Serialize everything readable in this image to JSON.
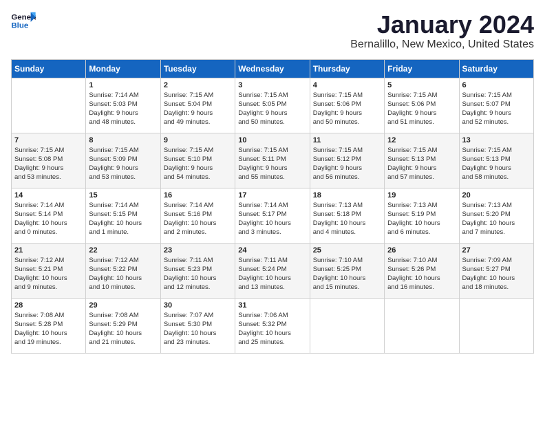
{
  "logo": {
    "line1": "General",
    "line2": "Blue"
  },
  "title": "January 2024",
  "location": "Bernalillo, New Mexico, United States",
  "days_header": [
    "Sunday",
    "Monday",
    "Tuesday",
    "Wednesday",
    "Thursday",
    "Friday",
    "Saturday"
  ],
  "weeks": [
    [
      {
        "num": "",
        "lines": []
      },
      {
        "num": "1",
        "lines": [
          "Sunrise: 7:14 AM",
          "Sunset: 5:03 PM",
          "Daylight: 9 hours",
          "and 48 minutes."
        ]
      },
      {
        "num": "2",
        "lines": [
          "Sunrise: 7:15 AM",
          "Sunset: 5:04 PM",
          "Daylight: 9 hours",
          "and 49 minutes."
        ]
      },
      {
        "num": "3",
        "lines": [
          "Sunrise: 7:15 AM",
          "Sunset: 5:05 PM",
          "Daylight: 9 hours",
          "and 50 minutes."
        ]
      },
      {
        "num": "4",
        "lines": [
          "Sunrise: 7:15 AM",
          "Sunset: 5:06 PM",
          "Daylight: 9 hours",
          "and 50 minutes."
        ]
      },
      {
        "num": "5",
        "lines": [
          "Sunrise: 7:15 AM",
          "Sunset: 5:06 PM",
          "Daylight: 9 hours",
          "and 51 minutes."
        ]
      },
      {
        "num": "6",
        "lines": [
          "Sunrise: 7:15 AM",
          "Sunset: 5:07 PM",
          "Daylight: 9 hours",
          "and 52 minutes."
        ]
      }
    ],
    [
      {
        "num": "7",
        "lines": [
          "Sunrise: 7:15 AM",
          "Sunset: 5:08 PM",
          "Daylight: 9 hours",
          "and 53 minutes."
        ]
      },
      {
        "num": "8",
        "lines": [
          "Sunrise: 7:15 AM",
          "Sunset: 5:09 PM",
          "Daylight: 9 hours",
          "and 53 minutes."
        ]
      },
      {
        "num": "9",
        "lines": [
          "Sunrise: 7:15 AM",
          "Sunset: 5:10 PM",
          "Daylight: 9 hours",
          "and 54 minutes."
        ]
      },
      {
        "num": "10",
        "lines": [
          "Sunrise: 7:15 AM",
          "Sunset: 5:11 PM",
          "Daylight: 9 hours",
          "and 55 minutes."
        ]
      },
      {
        "num": "11",
        "lines": [
          "Sunrise: 7:15 AM",
          "Sunset: 5:12 PM",
          "Daylight: 9 hours",
          "and 56 minutes."
        ]
      },
      {
        "num": "12",
        "lines": [
          "Sunrise: 7:15 AM",
          "Sunset: 5:13 PM",
          "Daylight: 9 hours",
          "and 57 minutes."
        ]
      },
      {
        "num": "13",
        "lines": [
          "Sunrise: 7:15 AM",
          "Sunset: 5:13 PM",
          "Daylight: 9 hours",
          "and 58 minutes."
        ]
      }
    ],
    [
      {
        "num": "14",
        "lines": [
          "Sunrise: 7:14 AM",
          "Sunset: 5:14 PM",
          "Daylight: 10 hours",
          "and 0 minutes."
        ]
      },
      {
        "num": "15",
        "lines": [
          "Sunrise: 7:14 AM",
          "Sunset: 5:15 PM",
          "Daylight: 10 hours",
          "and 1 minute."
        ]
      },
      {
        "num": "16",
        "lines": [
          "Sunrise: 7:14 AM",
          "Sunset: 5:16 PM",
          "Daylight: 10 hours",
          "and 2 minutes."
        ]
      },
      {
        "num": "17",
        "lines": [
          "Sunrise: 7:14 AM",
          "Sunset: 5:17 PM",
          "Daylight: 10 hours",
          "and 3 minutes."
        ]
      },
      {
        "num": "18",
        "lines": [
          "Sunrise: 7:13 AM",
          "Sunset: 5:18 PM",
          "Daylight: 10 hours",
          "and 4 minutes."
        ]
      },
      {
        "num": "19",
        "lines": [
          "Sunrise: 7:13 AM",
          "Sunset: 5:19 PM",
          "Daylight: 10 hours",
          "and 6 minutes."
        ]
      },
      {
        "num": "20",
        "lines": [
          "Sunrise: 7:13 AM",
          "Sunset: 5:20 PM",
          "Daylight: 10 hours",
          "and 7 minutes."
        ]
      }
    ],
    [
      {
        "num": "21",
        "lines": [
          "Sunrise: 7:12 AM",
          "Sunset: 5:21 PM",
          "Daylight: 10 hours",
          "and 9 minutes."
        ]
      },
      {
        "num": "22",
        "lines": [
          "Sunrise: 7:12 AM",
          "Sunset: 5:22 PM",
          "Daylight: 10 hours",
          "and 10 minutes."
        ]
      },
      {
        "num": "23",
        "lines": [
          "Sunrise: 7:11 AM",
          "Sunset: 5:23 PM",
          "Daylight: 10 hours",
          "and 12 minutes."
        ]
      },
      {
        "num": "24",
        "lines": [
          "Sunrise: 7:11 AM",
          "Sunset: 5:24 PM",
          "Daylight: 10 hours",
          "and 13 minutes."
        ]
      },
      {
        "num": "25",
        "lines": [
          "Sunrise: 7:10 AM",
          "Sunset: 5:25 PM",
          "Daylight: 10 hours",
          "and 15 minutes."
        ]
      },
      {
        "num": "26",
        "lines": [
          "Sunrise: 7:10 AM",
          "Sunset: 5:26 PM",
          "Daylight: 10 hours",
          "and 16 minutes."
        ]
      },
      {
        "num": "27",
        "lines": [
          "Sunrise: 7:09 AM",
          "Sunset: 5:27 PM",
          "Daylight: 10 hours",
          "and 18 minutes."
        ]
      }
    ],
    [
      {
        "num": "28",
        "lines": [
          "Sunrise: 7:08 AM",
          "Sunset: 5:28 PM",
          "Daylight: 10 hours",
          "and 19 minutes."
        ]
      },
      {
        "num": "29",
        "lines": [
          "Sunrise: 7:08 AM",
          "Sunset: 5:29 PM",
          "Daylight: 10 hours",
          "and 21 minutes."
        ]
      },
      {
        "num": "30",
        "lines": [
          "Sunrise: 7:07 AM",
          "Sunset: 5:30 PM",
          "Daylight: 10 hours",
          "and 23 minutes."
        ]
      },
      {
        "num": "31",
        "lines": [
          "Sunrise: 7:06 AM",
          "Sunset: 5:32 PM",
          "Daylight: 10 hours",
          "and 25 minutes."
        ]
      },
      {
        "num": "",
        "lines": []
      },
      {
        "num": "",
        "lines": []
      },
      {
        "num": "",
        "lines": []
      }
    ]
  ]
}
